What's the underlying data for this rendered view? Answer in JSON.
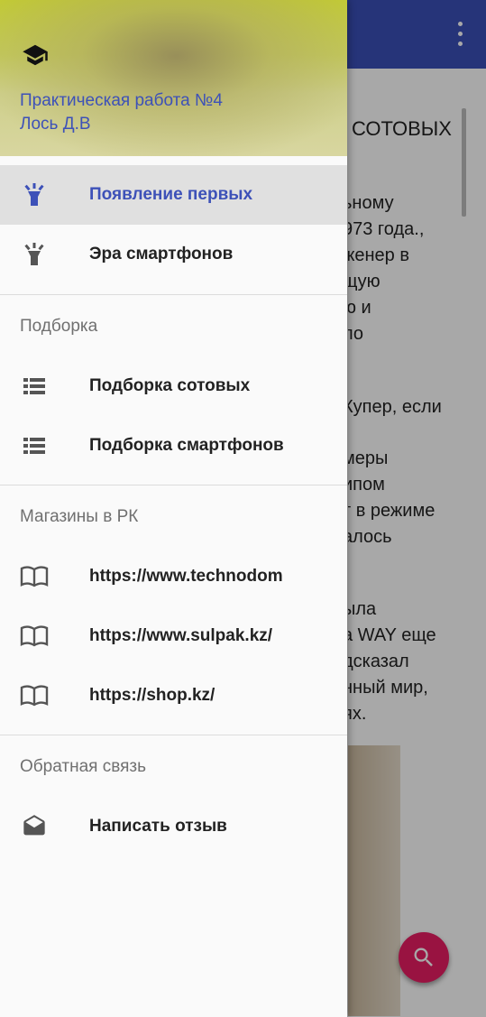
{
  "app": {
    "article_title": "СОТОВЫХ",
    "article_lines": [
      "ьному",
      "973 года.,",
      "женер в",
      "щую",
      "ю и",
      "ло",
      "",
      "Купер, если",
      "",
      "меры",
      "ипом",
      "т в режиме",
      "алось",
      "",
      "ыла",
      "а WAY еще",
      "дсказал",
      "нный мир,",
      "ях."
    ],
    "overflow_icon": "more-vert-icon",
    "fab_icon": "search-icon",
    "colors": {
      "app_bar": "#3b4fb8",
      "fab": "#e91e63",
      "accent": "#3d51b8"
    }
  },
  "drawer": {
    "header": {
      "icon": "graduation-cap-icon",
      "title": "Практическая работа №4",
      "subtitle": "Лось Д.В"
    },
    "group1": [
      {
        "label": "Появление первых",
        "icon": "flashlight-icon",
        "selected": true
      },
      {
        "label": "Эра смартфонов",
        "icon": "flashlight-icon",
        "selected": false
      }
    ],
    "section_selection": {
      "title": "Подборка",
      "items": [
        {
          "label": "Подборка сотовых",
          "icon": "list-icon"
        },
        {
          "label": "Подборка смартфонов",
          "icon": "list-icon"
        }
      ]
    },
    "section_shops": {
      "title": "Магазины в РК",
      "items": [
        {
          "label": "https://www.technodom",
          "icon": "book-icon"
        },
        {
          "label": "https://www.sulpak.kz/",
          "icon": "book-icon"
        },
        {
          "label": "https://shop.kz/",
          "icon": "book-icon"
        }
      ]
    },
    "section_feedback": {
      "title": "Обратная связь",
      "items": [
        {
          "label": "Написать отзыв",
          "icon": "drafts-icon"
        }
      ]
    }
  }
}
